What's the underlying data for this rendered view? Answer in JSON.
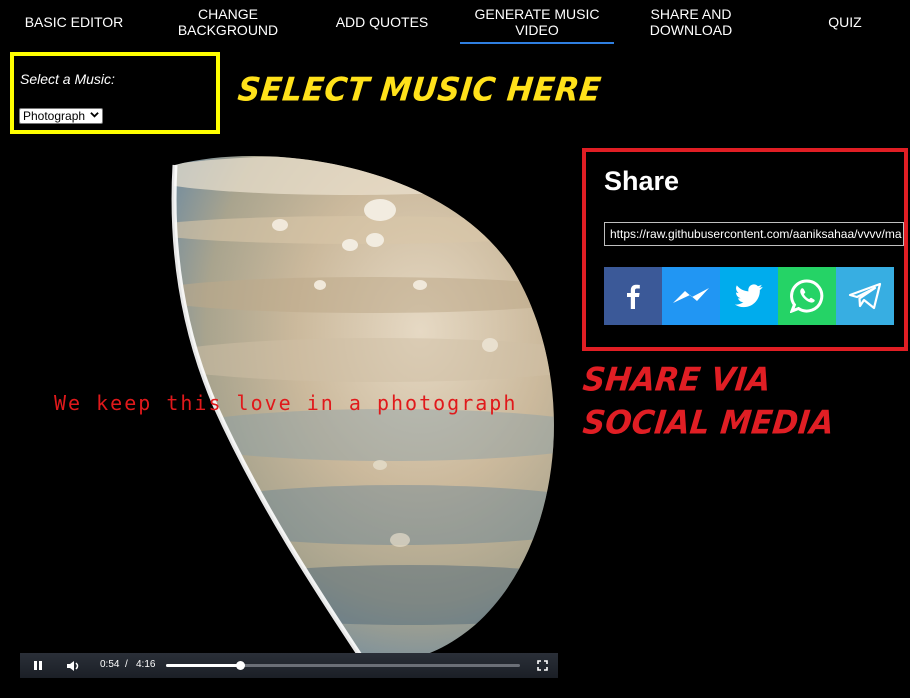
{
  "nav": {
    "tabs": [
      {
        "label": "BASIC EDITOR"
      },
      {
        "label": "CHANGE BACKGROUND"
      },
      {
        "label": "ADD QUOTES"
      },
      {
        "label": "GENERATE MUSIC VIDEO"
      },
      {
        "label": "SHARE AND DOWNLOAD"
      },
      {
        "label": "QUIZ"
      }
    ],
    "active_tab": "GENERATE MUSIC VIDEO",
    "active_color": "#2f7fe0"
  },
  "music": {
    "label": "Select a Music:",
    "selected": "Photograph",
    "annotation": "SELECT MUSIC HERE",
    "highlight_color": "#ffff00"
  },
  "video": {
    "caption": "We keep this love in a photograph",
    "current_time": "0:54",
    "separator": "/",
    "duration": "4:16",
    "progress_fraction": 0.21,
    "state": "playing"
  },
  "share": {
    "title": "Share",
    "url": "https://raw.githubusercontent.com/aaniksahaa/vvvv/ma",
    "annotation_line1": "SHARE VIA",
    "annotation_line2": "SOCIAL MEDIA",
    "highlight_color": "#e01e24",
    "buttons": [
      {
        "name": "facebook",
        "color": "#3b5998",
        "icon": "facebook-icon"
      },
      {
        "name": "messenger",
        "color": "#2196f3",
        "icon": "messenger-icon"
      },
      {
        "name": "twitter",
        "color": "#00aced",
        "icon": "twitter-icon"
      },
      {
        "name": "whatsapp",
        "color": "#25d366",
        "icon": "whatsapp-icon"
      },
      {
        "name": "telegram",
        "color": "#37aee2",
        "icon": "telegram-icon"
      }
    ]
  }
}
